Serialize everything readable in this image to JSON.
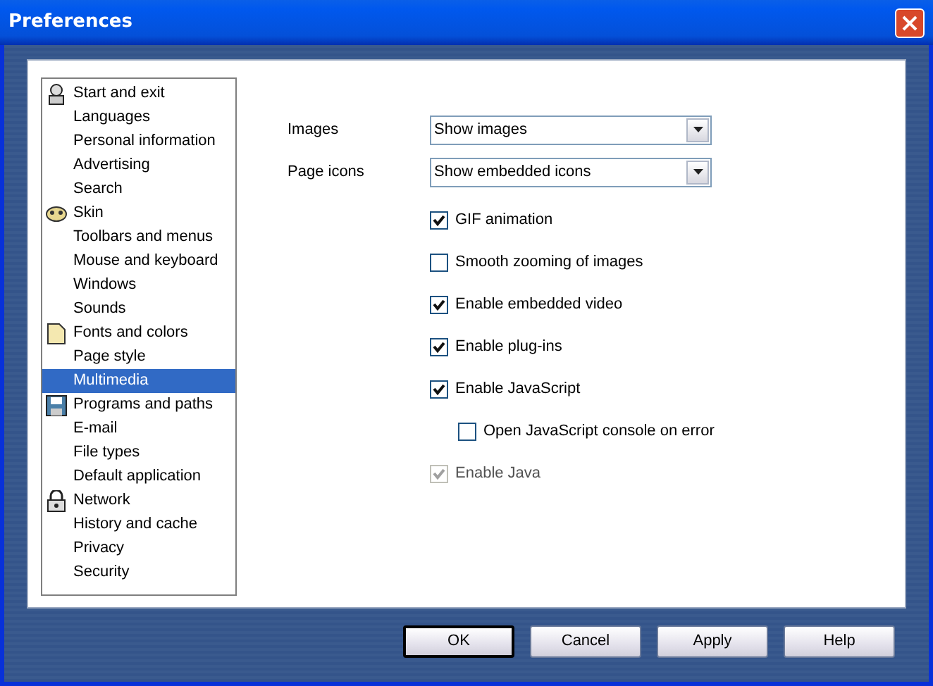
{
  "window": {
    "title": "Preferences"
  },
  "sidebar": {
    "items": [
      {
        "label": "Start and exit",
        "kind": "header",
        "selected": false
      },
      {
        "label": "Languages",
        "kind": "item",
        "selected": false
      },
      {
        "label": "Personal information",
        "kind": "item",
        "selected": false
      },
      {
        "label": "Advertising",
        "kind": "item",
        "selected": false
      },
      {
        "label": "Search",
        "kind": "item",
        "selected": false
      },
      {
        "label": "Skin",
        "kind": "header",
        "selected": false
      },
      {
        "label": "Toolbars and menus",
        "kind": "item",
        "selected": false
      },
      {
        "label": "Mouse and keyboard",
        "kind": "item",
        "selected": false
      },
      {
        "label": "Windows",
        "kind": "item",
        "selected": false
      },
      {
        "label": "Sounds",
        "kind": "item",
        "selected": false
      },
      {
        "label": "Fonts and colors",
        "kind": "header",
        "selected": false
      },
      {
        "label": "Page style",
        "kind": "item",
        "selected": false
      },
      {
        "label": "Multimedia",
        "kind": "item",
        "selected": true
      },
      {
        "label": "Programs and paths",
        "kind": "header",
        "selected": false
      },
      {
        "label": "E-mail",
        "kind": "item",
        "selected": false
      },
      {
        "label": "File types",
        "kind": "item",
        "selected": false
      },
      {
        "label": "Default application",
        "kind": "item",
        "selected": false
      },
      {
        "label": "Network",
        "kind": "header",
        "selected": false
      },
      {
        "label": "History and cache",
        "kind": "item",
        "selected": false
      },
      {
        "label": "Privacy",
        "kind": "item",
        "selected": false
      },
      {
        "label": "Security",
        "kind": "item",
        "selected": false
      }
    ]
  },
  "dropdowns": [
    {
      "label": "Images",
      "value": "Show images"
    },
    {
      "label": "Page icons",
      "value": "Show embedded icons"
    }
  ],
  "options": [
    {
      "label": "GIF animation",
      "checked": true,
      "disabled": false
    },
    {
      "label": "Smooth zooming of images",
      "checked": false,
      "disabled": false
    },
    {
      "label": "Enable embedded video",
      "checked": true,
      "disabled": false
    },
    {
      "label": "Enable plug-ins",
      "checked": true,
      "disabled": false
    },
    {
      "label": "Enable JavaScript",
      "checked": true,
      "disabled": false,
      "children": [
        {
          "label": "Open JavaScript console on error",
          "checked": false,
          "disabled": false
        }
      ]
    },
    {
      "label": "Enable Java",
      "checked": true,
      "disabled": true
    }
  ],
  "buttons": [
    {
      "label": "OK",
      "default": true
    },
    {
      "label": "Cancel",
      "default": false
    },
    {
      "label": "Apply",
      "default": false
    },
    {
      "label": "Help",
      "default": false
    }
  ]
}
